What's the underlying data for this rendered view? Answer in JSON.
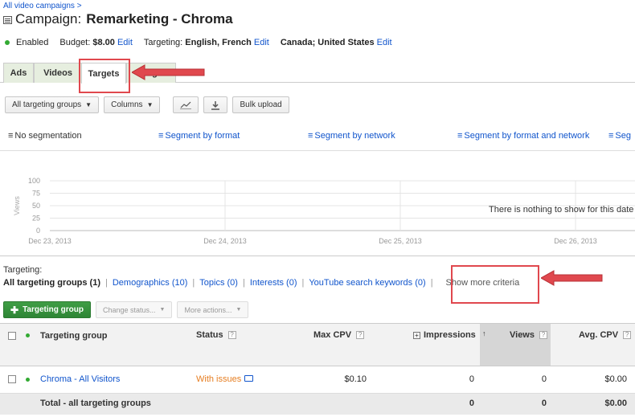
{
  "breadcrumb": "All video campaigns >",
  "campaign": {
    "prefix": "Campaign:",
    "name": "Remarketing - Chroma"
  },
  "status": {
    "state": "Enabled",
    "budget_label": "Budget:",
    "budget_value": "$8.00",
    "budget_edit": "Edit",
    "targeting_label": "Targeting:",
    "targeting_value": "English, French",
    "targeting_edit": "Edit",
    "locations_value": "Canada; United States",
    "locations_edit": "Edit"
  },
  "tabs": [
    {
      "label": "Ads"
    },
    {
      "label": "Videos"
    },
    {
      "label": "Targets",
      "active": true
    },
    {
      "label": "Settings"
    }
  ],
  "tabs_settings_visible": "ttings",
  "toolbar": {
    "groups": "All targeting groups",
    "columns": "Columns",
    "chart_icon": "line-chart-icon",
    "download_icon": "download-icon",
    "bulk": "Bulk upload"
  },
  "segments": {
    "none": "No segmentation",
    "format": "Segment by format",
    "network": "Segment by network",
    "format_network": "Segment by format and network",
    "cut": "Seg"
  },
  "chart_data": {
    "type": "line",
    "ylabel": "Views",
    "yticks": [
      0,
      25,
      50,
      75,
      100
    ],
    "ylim": [
      0,
      100
    ],
    "x": [
      "Dec 23, 2013",
      "Dec 24, 2013",
      "Dec 25, 2013",
      "Dec 26, 2013"
    ],
    "series": [],
    "grid": true,
    "empty_message": "There is nothing to show for this date"
  },
  "targeting": {
    "label": "Targeting:",
    "current": "All targeting groups (1)",
    "links": [
      "Demographics (10)",
      "Topics (0)",
      "Interests (0)",
      "YouTube search keywords (0)"
    ],
    "more": "Show more criteria"
  },
  "actions": {
    "add": "Targeting group",
    "change_status": "Change status...",
    "more_actions": "More actions..."
  },
  "table": {
    "headers": {
      "group": "Targeting group",
      "status": "Status",
      "max_cpv": "Max CPV",
      "impressions": "Impressions",
      "views": "Views",
      "avg_cpv": "Avg. CPV"
    },
    "rows": [
      {
        "group": "Chroma - All Visitors",
        "status": "With issues",
        "max_cpv": "$0.10",
        "impressions": "0",
        "views": "0",
        "avg_cpv": "$0.00"
      }
    ],
    "total": {
      "label": "Total - all targeting groups",
      "impressions": "0",
      "views": "0",
      "avg_cpv": "$0.00"
    }
  },
  "colors": {
    "accent": "#1155cc",
    "green": "#33aa33",
    "warning": "#e67e22",
    "annotation": "#e0484e"
  }
}
